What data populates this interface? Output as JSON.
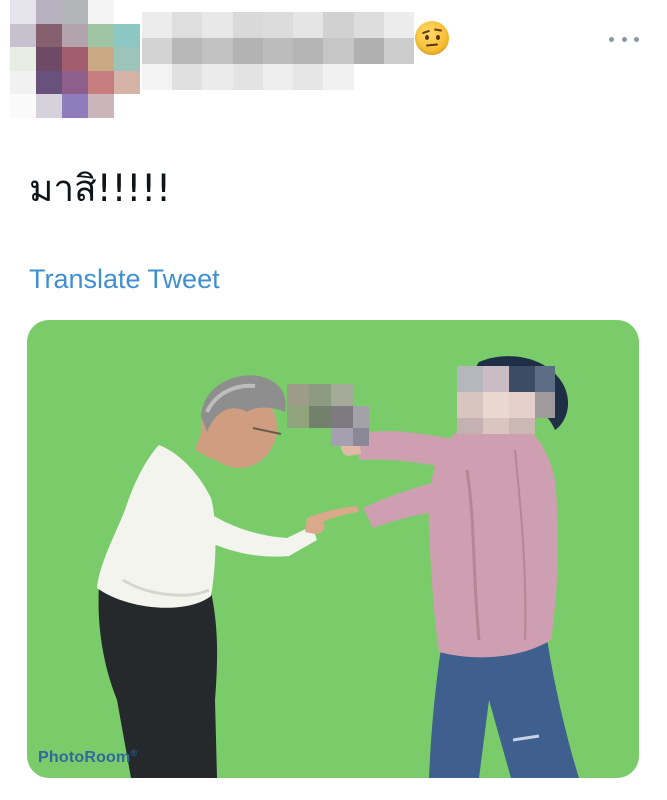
{
  "tweet": {
    "text": "มาสิ!!!!!",
    "translate_label": "Translate Tweet"
  },
  "media": {
    "watermark": "PhotoRoom",
    "watermark_mark": "®",
    "background_color": "#7acc6a"
  },
  "colors": {
    "link": "#3f8fd2",
    "text": "#0f1419",
    "icon_muted": "#8b98a5"
  },
  "icons": {
    "emoji": "face-with-raised-eyebrow-emoji",
    "menu": "more-horizontal-icon"
  }
}
